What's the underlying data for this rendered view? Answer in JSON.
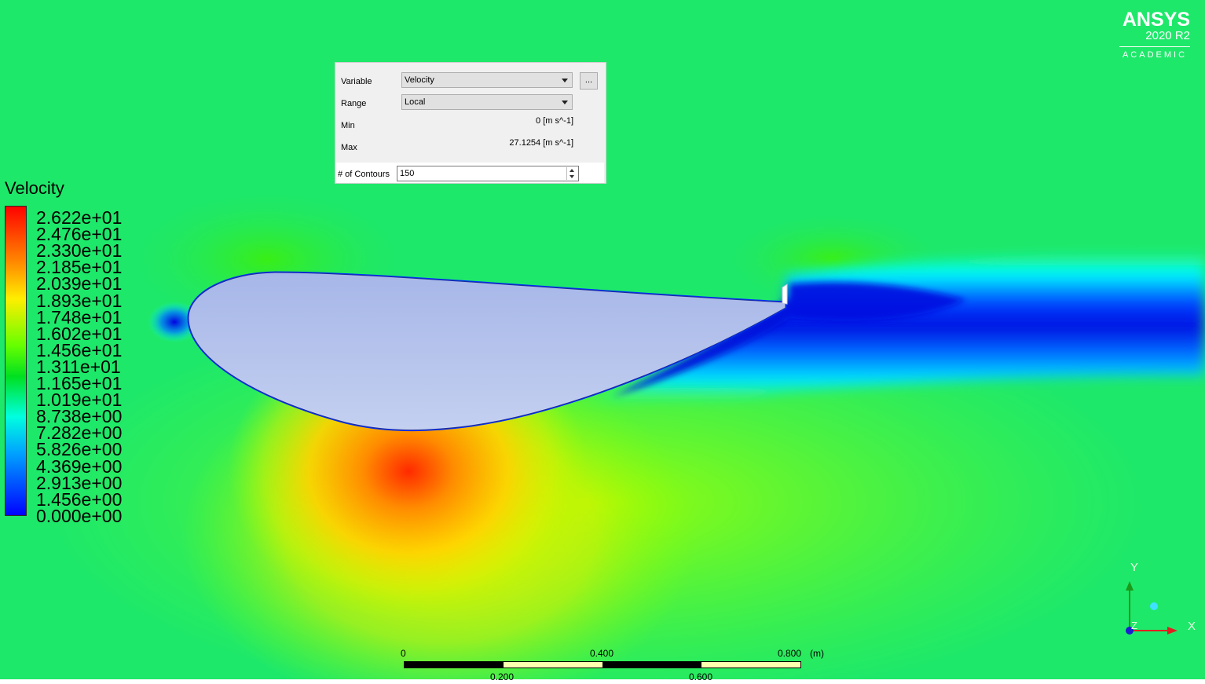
{
  "panel": {
    "variable_label": "Variable",
    "variable_value": "Velocity",
    "more_label": "...",
    "range_label": "Range",
    "range_value": "Local",
    "min_label": "Min",
    "min_value": "0 [m s^-1]",
    "max_label": "Max",
    "max_value": "27.1254 [m s^-1]",
    "contours_label": "# of Contours",
    "contours_value": "150"
  },
  "legend": {
    "title": "Velocity",
    "labels": [
      "2.622e+01",
      "2.476e+01",
      "2.330e+01",
      "2.185e+01",
      "2.039e+01",
      "1.893e+01",
      "1.748e+01",
      "1.602e+01",
      "1.456e+01",
      "1.311e+01",
      "1.165e+01",
      "1.019e+01",
      "8.738e+00",
      "7.282e+00",
      "5.826e+00",
      "4.369e+00",
      "2.913e+00",
      "1.456e+00",
      "0.000e+00"
    ]
  },
  "logo": {
    "name": "ANSYS",
    "version": "2020 R2",
    "edition": "ACADEMIC"
  },
  "scale": {
    "top_ticks": [
      "0",
      "0.400",
      "0.800"
    ],
    "unit": "(m)",
    "bottom_ticks": [
      "0.200",
      "0.600"
    ]
  },
  "axes": {
    "x_label": "X",
    "y_label": "Y",
    "z_label": "Z"
  },
  "colors": {
    "freestream": "#1ee86a",
    "airfoil_fill": "#b4c2ea",
    "x_axis": "#e02020",
    "y_axis": "#1a9a1a",
    "z_axis": "#1c1cd0"
  }
}
